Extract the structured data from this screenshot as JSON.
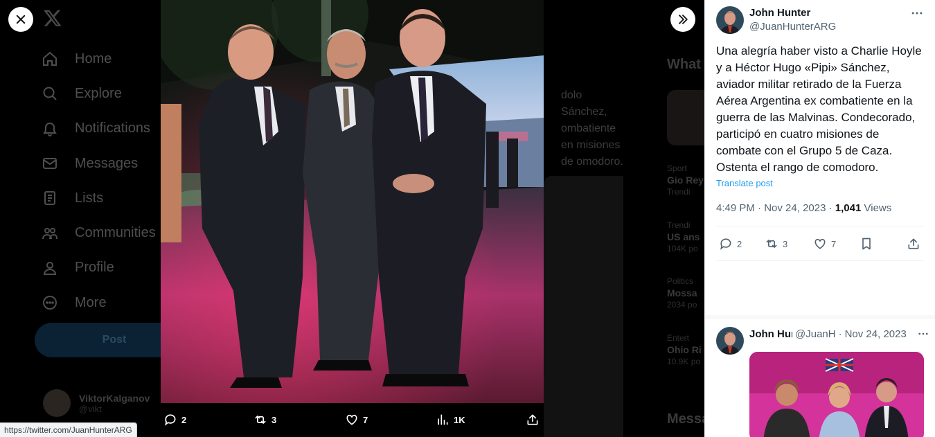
{
  "background": {
    "nav": [
      {
        "label": "Home",
        "icon": "home-icon"
      },
      {
        "label": "Explore",
        "icon": "search-icon"
      },
      {
        "label": "Notifications",
        "icon": "bell-icon"
      },
      {
        "label": "Messages",
        "icon": "mail-icon"
      },
      {
        "label": "Lists",
        "icon": "list-icon"
      },
      {
        "label": "Communities",
        "icon": "communities-icon"
      },
      {
        "label": "Profile",
        "icon": "person-icon"
      },
      {
        "label": "More",
        "icon": "more-circle-icon"
      }
    ],
    "post_button": "Post",
    "account": {
      "name": "ViktorKalganov",
      "handle": "@vikt"
    },
    "tweet_fragment": "dolo Sánchez, ombatiente en misiones de omodoro.",
    "whats_happening": "What",
    "trends": [
      {
        "context": "Sport",
        "title": "Gio Rey",
        "sub": "Trendi"
      },
      {
        "context": "Trendi",
        "title": "US ans",
        "sub": "104K po"
      },
      {
        "context": "Politics",
        "title": "Mossa",
        "sub": "2034 po"
      },
      {
        "context": "Entert",
        "title": "Ohio Ri",
        "sub": "10.9K po"
      }
    ],
    "messages_heading": "Messa"
  },
  "media_actions": {
    "replies": "2",
    "reposts": "3",
    "likes": "7",
    "views": "1K"
  },
  "tweet": {
    "author_name": "John Hunter",
    "author_handle": "@JuanHunterARG",
    "text": "Una alegría haber visto a Charlie Hoyle y a Héctor Hugo «Pipi» Sánchez, aviador militar retirado de la Fuerza Aérea Argentina ex combatiente en la guerra de las Malvinas. Condecorado, participó en cuatro misiones de combate con el Grupo 5 de Caza. Ostenta el rango de comodoro.",
    "translate": "Translate post",
    "time": "4:49 PM",
    "date": "Nov 24, 2023",
    "views_count": "1,041",
    "views_label": "Views",
    "replies": "2",
    "reposts": "3",
    "likes": "7"
  },
  "reply": {
    "name": "John Hunter",
    "handle": "@JuanH",
    "date": "Nov 24, 2023"
  },
  "status_url": "https://twitter.com/JuanHunterARG",
  "colors": {
    "accent": "#1d9bf0",
    "secondary_text": "#536471",
    "primary_text": "#0f1419"
  }
}
